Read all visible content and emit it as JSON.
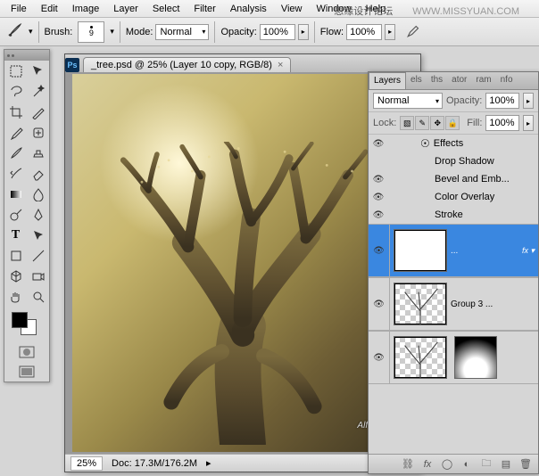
{
  "menu": {
    "items": [
      "File",
      "Edit",
      "Image",
      "Layer",
      "Select",
      "Filter",
      "Analysis",
      "View",
      "Window",
      "Help"
    ]
  },
  "watermark": {
    "cn": "思缘设计论坛",
    "en": "WWW.MISSYUAN.COM"
  },
  "options": {
    "brush_label": "Brush:",
    "brush_size": "9",
    "mode_label": "Mode:",
    "mode_value": "Normal",
    "opacity_label": "Opacity:",
    "opacity_value": "100%",
    "flow_label": "Flow:",
    "flow_value": "100%"
  },
  "document": {
    "tab_title": "_tree.psd @ 25% (Layer 10 copy, RGB/8)",
    "zoom": "25%",
    "doc_size": "Doc: 17.3M/176.2M",
    "credit": "Alfoart.com"
  },
  "layers_panel": {
    "tabs": [
      "Layers",
      "els",
      "ths",
      "ator",
      "ram",
      "nfo"
    ],
    "blend_mode": "Normal",
    "opacity_label": "Opacity:",
    "opacity_value": "100%",
    "lock_label": "Lock:",
    "fill_label": "Fill:",
    "fill_value": "100%",
    "effects_label": "Effects",
    "effects": [
      "Drop Shadow",
      "Bevel and Emb...",
      "Color Overlay",
      "Stroke"
    ],
    "layers": [
      {
        "name": "...",
        "selected": true,
        "has_fx": true,
        "thumb": "blank"
      },
      {
        "name": "Group 3 ...",
        "selected": false,
        "has_fx": false,
        "thumb": "tree"
      },
      {
        "name": "",
        "selected": false,
        "has_fx": false,
        "thumb": "tree",
        "has_mask": true
      }
    ]
  },
  "tools": [
    "move",
    "marquee",
    "lasso",
    "magic-wand",
    "crop",
    "slice",
    "eyedropper",
    "healing",
    "brush",
    "clone",
    "history-brush",
    "eraser",
    "gradient",
    "blur",
    "dodge",
    "pen",
    "type",
    "path-select",
    "rectangle",
    "line",
    "notes",
    "hand",
    "zoom",
    "rotate"
  ],
  "icons": {
    "brush": "brush-icon",
    "airbrush": "airbrush-icon",
    "eye": "visibility-icon",
    "link": "link-icon",
    "fx": "fx-icon",
    "mask": "mask-icon",
    "adjust": "adjustment-icon",
    "group": "group-icon",
    "new": "new-layer-icon",
    "trash": "trash-icon"
  }
}
